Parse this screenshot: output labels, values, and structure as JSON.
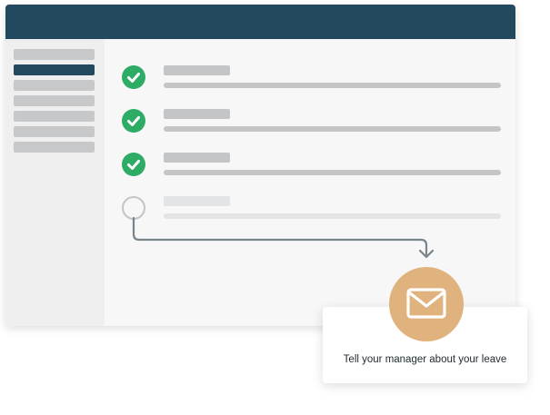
{
  "app": {
    "sidebar": {
      "items": [
        {
          "state": "inactive"
        },
        {
          "state": "active"
        },
        {
          "state": "inactive"
        },
        {
          "state": "inactive"
        },
        {
          "state": "inactive"
        },
        {
          "state": "inactive"
        },
        {
          "state": "inactive"
        }
      ]
    },
    "tasks": [
      {
        "status": "done",
        "icon": "check-icon"
      },
      {
        "status": "done",
        "icon": "check-icon"
      },
      {
        "status": "done",
        "icon": "check-icon"
      },
      {
        "status": "pending",
        "icon": "empty-circle-icon"
      }
    ]
  },
  "notification": {
    "icon": "envelope-icon",
    "message": "Tell your manager about your leave"
  },
  "colors": {
    "header": "#23495e",
    "active_sidebar": "#23495e",
    "check_green": "#2eac66",
    "mail_badge": "#e0b27e",
    "placeholder_gray": "#c3c5c7"
  }
}
